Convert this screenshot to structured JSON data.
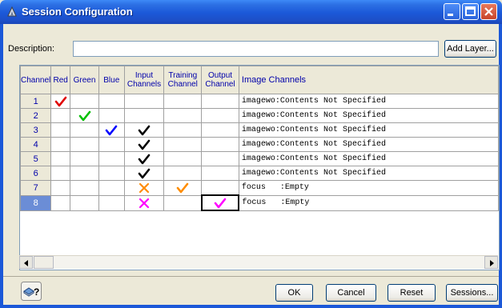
{
  "window": {
    "title": "Session Configuration"
  },
  "description": {
    "label": "Description:",
    "value": ""
  },
  "add_layer_label": "Add Layer...",
  "columns": {
    "channel": "Channel",
    "red": "Red",
    "green": "Green",
    "blue": "Blue",
    "input": "Input Channels",
    "training": "Training Channel",
    "output": "Output Channel",
    "image": "Image Channels"
  },
  "rows": [
    {
      "channel": "1",
      "red": "check",
      "green": "",
      "blue": "",
      "input": "",
      "training": "",
      "output": "",
      "image": "imagewo:Contents Not Specified"
    },
    {
      "channel": "2",
      "red": "",
      "green": "check",
      "blue": "",
      "input": "",
      "training": "",
      "output": "",
      "image": "imagewo:Contents Not Specified"
    },
    {
      "channel": "3",
      "red": "",
      "green": "",
      "blue": "check",
      "input": "check",
      "training": "",
      "output": "",
      "image": "imagewo:Contents Not Specified"
    },
    {
      "channel": "4",
      "red": "",
      "green": "",
      "blue": "",
      "input": "check",
      "training": "",
      "output": "",
      "image": "imagewo:Contents Not Specified"
    },
    {
      "channel": "5",
      "red": "",
      "green": "",
      "blue": "",
      "input": "check",
      "training": "",
      "output": "",
      "image": "imagewo:Contents Not Specified"
    },
    {
      "channel": "6",
      "red": "",
      "green": "",
      "blue": "",
      "input": "check",
      "training": "",
      "output": "",
      "image": "imagewo:Contents Not Specified"
    },
    {
      "channel": "7",
      "red": "",
      "green": "",
      "blue": "",
      "input": "cross",
      "training": "check",
      "output": "",
      "image": "focus   :Empty"
    },
    {
      "channel": "8",
      "red": "",
      "green": "",
      "blue": "",
      "input": "cross",
      "training": "",
      "output": "check",
      "image": "focus   :Empty"
    }
  ],
  "selected_row_channel": "8",
  "colors": {
    "red": "#e00000",
    "green": "#00c000",
    "blue": "#0000ff",
    "input_check": "#000000",
    "input_cross_7": "#ff8c00",
    "input_cross_8": "#ff00ff",
    "training": "#ff8c00",
    "output": "#ff00ff",
    "title_bar": "#1b58d8",
    "header_text": "#0000aa"
  },
  "icons": {
    "title": "session-app-icon",
    "help": "context-help-icon",
    "check": "check-mark-icon",
    "cross": "cross-mark-icon"
  },
  "buttons": {
    "ok": "OK",
    "cancel": "Cancel",
    "reset": "Reset",
    "sessions": "Sessions..."
  }
}
